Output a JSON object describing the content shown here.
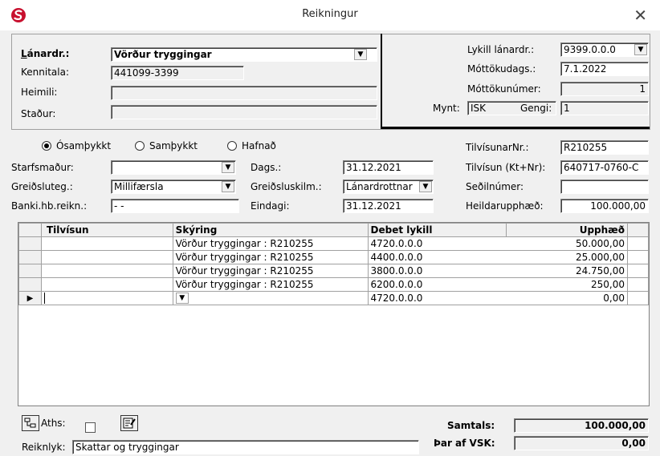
{
  "window": {
    "title": "Reikningur"
  },
  "header": {
    "lanardr_label": "Lánardr.:",
    "lanardr_value": "Vörður tryggingar",
    "kennitala_label": "Kennitala:",
    "kennitala_value": "441099-3399",
    "heimili_label": "Heimili:",
    "heimili_value": "",
    "stadur_label": "Staður:",
    "stadur_value": "",
    "lykill_label": "Lykill lánardr.:",
    "lykill_value": "9399.0.0.0",
    "mottokudags_label": "Móttökudags.:",
    "mottokudags_value": "7.1.2022",
    "mottokunumer_label": "Móttökunúmer:",
    "mottokunumer_value": "1",
    "mynt_label": "Mynt:",
    "mynt_value": "ISK",
    "gengi_label": "Gengi:",
    "gengi_value": "1"
  },
  "status": {
    "options": [
      "Ósamþykkt",
      "Samþykkt",
      "Hafnað"
    ],
    "selected": "Ósamþykkt"
  },
  "details": {
    "starfsmadur_label": "Starfsmaður:",
    "starfsmadur_value": "",
    "greidsluteg_label": "Greiðsluteg.:",
    "greidsluteg_value": "Millifærsla",
    "banki_label": "Banki.hb.reikn.:",
    "banki_value": "  -  -",
    "dags_label": "Dags.:",
    "dags_value": "31.12.2021",
    "greidsluskilm_label": "Greiðsluskilm.:",
    "greidsluskilm_value": "Lánardrottnar",
    "eindagi_label": "Eindagi:",
    "eindagi_value": "31.12.2021",
    "tilvisunarnr_label": "TilvísunarNr.:",
    "tilvisunarnr_value": "R210255",
    "tilvisun_kt_label": "Tilvísun (Kt+Nr):",
    "tilvisun_kt_value": "640717-0760-C",
    "sedilnumer_label": "Seðilnúmer:",
    "sedilnumer_value": "",
    "heildarupphaed_label": "Heildarupphæð:",
    "heildarupphaed_value": "100.000,00"
  },
  "grid": {
    "columns": [
      "Tilvísun",
      "Skýring",
      "Debet lykill",
      "",
      "Upphæð"
    ],
    "rows": [
      {
        "tilvisun": "",
        "skyring": "Vörður tryggingar : R210255",
        "debet": "4720.0.0.0",
        "upphaed": "50.000,00"
      },
      {
        "tilvisun": "",
        "skyring": "Vörður tryggingar : R210255",
        "debet": "4400.0.0.0",
        "upphaed": "25.000,00"
      },
      {
        "tilvisun": "",
        "skyring": "Vörður tryggingar : R210255",
        "debet": "3800.0.0.0",
        "upphaed": "24.750,00"
      },
      {
        "tilvisun": "",
        "skyring": "Vörður tryggingar : R210255",
        "debet": "6200.0.0.0",
        "upphaed": "250,00"
      },
      {
        "tilvisun": "",
        "skyring": "",
        "debet": "4720.0.0.0",
        "upphaed": "0,00"
      }
    ]
  },
  "footer": {
    "aths_label": "Aths:",
    "reiknlyk_label": "Reiknlyk:",
    "reiknlyk_value": "Skattar og tryggingar",
    "samtals_label": "Samtals:",
    "samtals_value": "100.000,00",
    "vsk_label": "Þar af VSK:",
    "vsk_value": "0,00"
  },
  "icons": [
    "app-logo-icon",
    "close-icon",
    "dropdown-arrow-icon",
    "row-pointer-icon",
    "tree-icon",
    "edit-note-icon"
  ],
  "colors": {
    "logo_red": "#c8102e",
    "logo_blue": "#1f3a93"
  }
}
